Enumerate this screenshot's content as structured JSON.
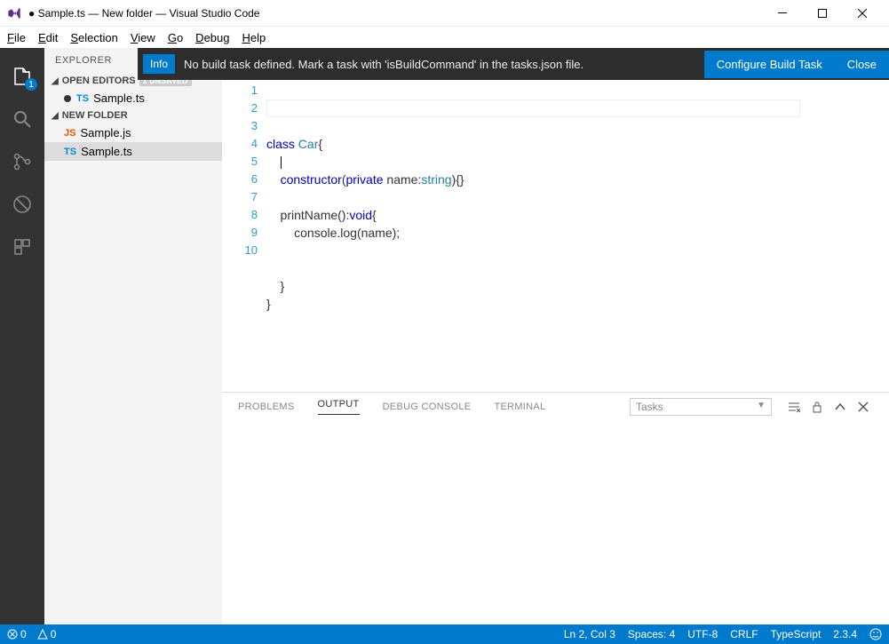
{
  "window": {
    "title": "● Sample.ts — New folder — Visual Studio Code"
  },
  "menubar": [
    "File",
    "Edit",
    "Selection",
    "View",
    "Go",
    "Debug",
    "Help"
  ],
  "activitybar": {
    "files_badge": "1"
  },
  "sidebar": {
    "title": "EXPLORER",
    "open_editors_label": "OPEN EDITORS",
    "unsaved_label": "1 UNSAVED",
    "open_editors": [
      {
        "ext": "TS",
        "ext_class": "ts",
        "name": "Sample.ts",
        "dirty": true
      }
    ],
    "folder_label": "NEW FOLDER",
    "files": [
      {
        "ext": "JS",
        "ext_class": "js",
        "name": "Sample.js"
      },
      {
        "ext": "TS",
        "ext_class": "ts",
        "name": "Sample.ts",
        "active": true
      }
    ]
  },
  "notification": {
    "tag": "Info",
    "message": "No build task defined. Mark a task with 'isBuildCommand' in the tasks.json file.",
    "primary": "Configure Build Task",
    "close": "Close"
  },
  "editor": {
    "line_numbers": [
      "1",
      "2",
      "3",
      "4",
      "5",
      "6",
      "7",
      "8",
      "9",
      "10"
    ],
    "code_lines": [
      {
        "html": "<span class='kw'>class</span> <span class='id'>Car</span>{"
      },
      {
        "html": "    <span class='cursor-bar'></span>"
      },
      {
        "html": "    <span class='kw'>constructor</span>(<span class='kw'>private</span> name:<span class='id'>string</span>){}"
      },
      {
        "html": ""
      },
      {
        "html": "    printName():<span class='kw'>void</span>{"
      },
      {
        "html": "        console.log(name);"
      },
      {
        "html": ""
      },
      {
        "html": ""
      },
      {
        "html": "    }"
      },
      {
        "html": "}"
      }
    ]
  },
  "panel": {
    "tabs": [
      "PROBLEMS",
      "OUTPUT",
      "DEBUG CONSOLE",
      "TERMINAL"
    ],
    "active_tab": "OUTPUT",
    "select_value": "Tasks"
  },
  "statusbar": {
    "errors": "0",
    "warnings": "0",
    "ln_col": "Ln 2, Col 3",
    "spaces": "Spaces: 4",
    "encoding": "UTF-8",
    "eol": "CRLF",
    "lang": "TypeScript",
    "tsver": "2.3.4"
  }
}
